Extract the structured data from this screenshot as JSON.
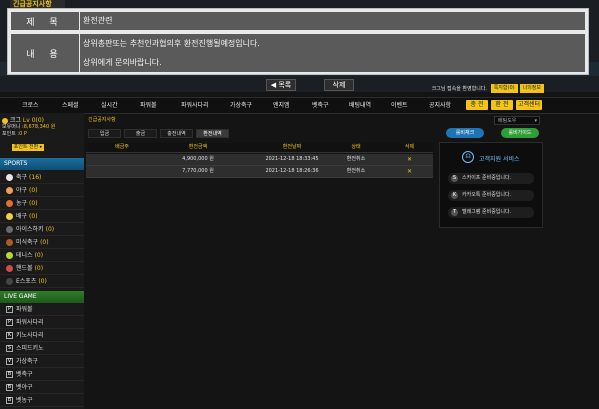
{
  "notice": {
    "tab": "긴급공지사항",
    "subject_label": "제 목",
    "subject": "환전관련",
    "content_label": "내 용",
    "content_lines": [
      "상위총판또는 추천인과협의후 환전진행될예정입니다.",
      "상위에게 문의바랍니다."
    ],
    "prev_label": "◀ 목록",
    "close_label": "삭제"
  },
  "welcome": "크그님 접속을 환영합니다.",
  "account_buttons": [
    "쪽지함(0)",
    "나의정보"
  ],
  "nav": {
    "items": [
      "크로스",
      "스페셜",
      "실시간",
      "파워볼",
      "파워사다리",
      "가상축구",
      "엔지엠",
      "벳축구",
      "배팅내역",
      "이벤트",
      "공지사항"
    ],
    "buttons": [
      "충 전",
      "환 전",
      "고객센터"
    ]
  },
  "user": {
    "name": "크그",
    "level": "Lv 0(0)",
    "money_label": "보유머니 :",
    "money": "8,678,340 원",
    "point_label": "포인트 :",
    "point": "0 P",
    "charge_button": "포인트 전환 ▸"
  },
  "sports": {
    "title": "SPORTS",
    "items": [
      {
        "name": "축구",
        "count": "(16)",
        "color": "#e6e6e6"
      },
      {
        "name": "야구",
        "count": "(0)",
        "color": "#f0a050"
      },
      {
        "name": "농구",
        "count": "(0)",
        "color": "#e07030"
      },
      {
        "name": "배구",
        "count": "(0)",
        "color": "#f0d040"
      },
      {
        "name": "아이스하키",
        "count": "(0)",
        "color": "#6a6a6a"
      },
      {
        "name": "미식축구",
        "count": "(0)",
        "color": "#b05a2a"
      },
      {
        "name": "테니스",
        "count": "(0)",
        "color": "#b8d830"
      },
      {
        "name": "핸드볼",
        "count": "(0)",
        "color": "#d04a4a"
      },
      {
        "name": "E스포츠",
        "count": "(0)",
        "color": "#444444"
      }
    ]
  },
  "live": {
    "title": "LIVE GAME",
    "items": [
      {
        "name": "파워볼",
        "mark": "P"
      },
      {
        "name": "파워사다리",
        "mark": "P"
      },
      {
        "name": "키노사다리",
        "mark": "K"
      },
      {
        "name": "스피드키노",
        "mark": "S"
      },
      {
        "name": "가상축구",
        "mark": "V"
      },
      {
        "name": "벳축구",
        "mark": "B"
      },
      {
        "name": "벳야구",
        "mark": "B"
      },
      {
        "name": "벳농구",
        "mark": "B"
      }
    ]
  },
  "main": {
    "breadcrumb": "긴급공지사항",
    "tabs": [
      "입금",
      "출금",
      "충전내역",
      "환전내역"
    ],
    "active_tab": 3,
    "table_headers": [
      "배금주",
      "환전금액",
      "환전날짜",
      "상태",
      "삭제"
    ],
    "rows": [
      {
        "user": "",
        "amount": "4,900,000 원",
        "date": "2021-12-18 18:33:45",
        "status": "환전취소",
        "delete": "✕"
      },
      {
        "user": "",
        "amount": "7,770,000 원",
        "date": "2021-12-18 18:26:36",
        "status": "환전취소",
        "delete": "✕"
      }
    ]
  },
  "right": {
    "select": "배팅도우",
    "btn_live": "롤비채크",
    "btn_green": "롤비가이드",
    "cs_title": "고객지원 서비스",
    "cs_items": [
      {
        "icon": "S",
        "label": "스카이프 준비중입니다."
      },
      {
        "icon": "K",
        "label": "카카오톡 준비중입니다."
      },
      {
        "icon": "T",
        "label": "텔레그램 준비중입니다."
      }
    ]
  }
}
